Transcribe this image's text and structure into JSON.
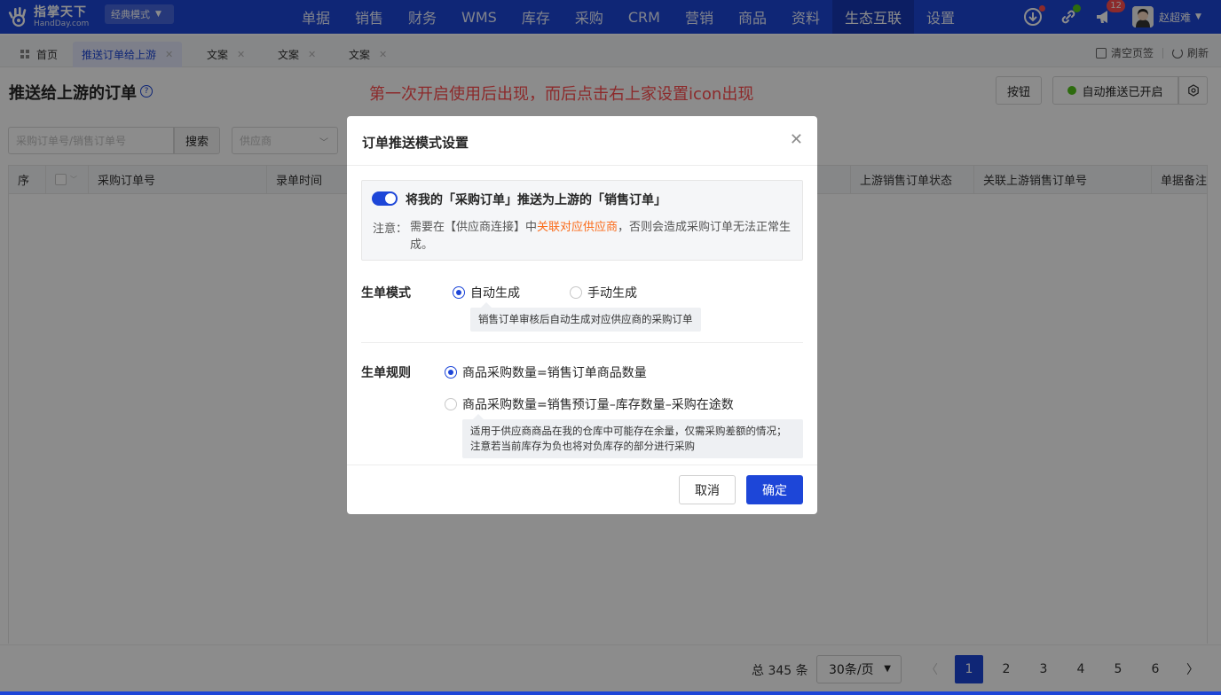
{
  "brand": {
    "name_cn": "指掌天下",
    "name_en": "HandDay.com",
    "mode": "经典模式"
  },
  "nav": {
    "items": [
      "单据",
      "销售",
      "财务",
      "WMS",
      "库存",
      "采购",
      "CRM",
      "营销",
      "商品",
      "资料",
      "生态互联",
      "设置"
    ],
    "active": "生态互联",
    "notification_count": "12",
    "user_name": "赵超难"
  },
  "tabs": [
    {
      "label": "首页"
    },
    {
      "label": "推送订单给上游"
    },
    {
      "label": "文案"
    },
    {
      "label": "文案"
    },
    {
      "label": "文案"
    }
  ],
  "strip_actions": {
    "clear": "清空页签",
    "refresh": "刷新"
  },
  "page": {
    "title": "推送给上游的订单",
    "help": "?",
    "red_note": "第一次开启使用后出现，而后点击右上家设置icon出现",
    "button_label": "按钮",
    "auto_push_label": "自动推送已开启"
  },
  "filters": {
    "order_placeholder": "采购订单号/销售订单号",
    "search_label": "搜索",
    "supplier_placeholder": "供应商"
  },
  "table": {
    "columns": [
      "序",
      "",
      "采购订单号",
      "录单时间",
      "上游销售订单状态",
      "关联上游销售订单号",
      "单据备注"
    ]
  },
  "pagination": {
    "total": "总 345 条",
    "per_page": "30条/页",
    "pages": [
      "1",
      "2",
      "3",
      "4",
      "5",
      "6"
    ],
    "current": "1"
  },
  "modal": {
    "title": "订单推送模式设置",
    "switch_label": "将我的「采购订单」推送为上游的「销售订单」",
    "note_prefix": "注意：",
    "note_before": "需要在【供应商连接】中",
    "note_link": "关联对应供应商",
    "note_after": "，否则会造成采购订单无法正常生成。",
    "mode_label": "生单模式",
    "mode_options": [
      "自动生成",
      "手动生成"
    ],
    "mode_selected": "自动生成",
    "mode_tip": "销售订单审核后自动生成对应供应商的采购订单",
    "rule_label": "生单规则",
    "rule_options": [
      "商品采购数量=销售订单商品数量",
      "商品采购数量=销售预订量–库存数量–采购在途数"
    ],
    "rule_selected": "商品采购数量=销售订单商品数量",
    "rule_tip_line1": "适用于供应商商品在我的仓库中可能存在余量，仅需采购差额的情况；",
    "rule_tip_line2": "注意若当前库存为负也将对负库存的部分进行采购",
    "cancel_label": "取消",
    "ok_label": "确定"
  },
  "colors": {
    "primary": "#1d46d8",
    "danger": "#ff4d4f",
    "success": "#52c41a",
    "link": "#fa6b1a"
  }
}
